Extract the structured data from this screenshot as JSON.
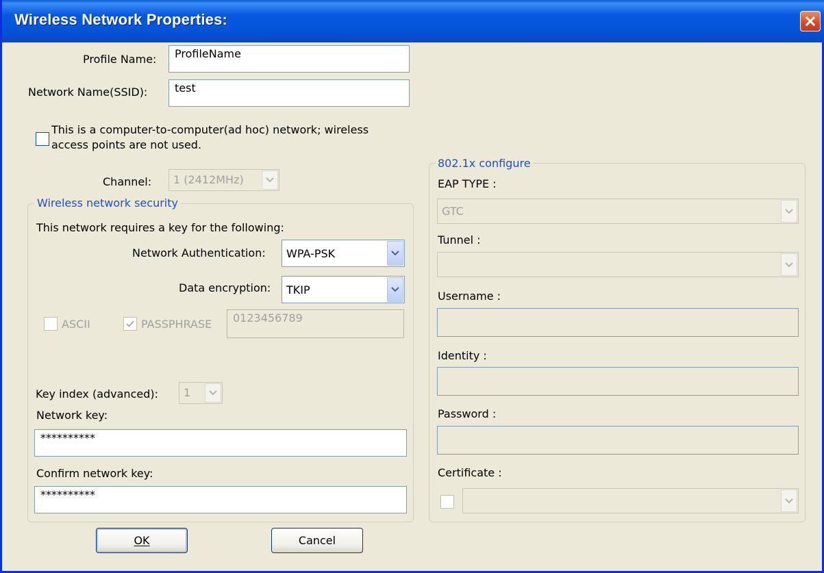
{
  "window": {
    "title": "Wireless Network Properties:"
  },
  "profile": {
    "label": "Profile Name:",
    "value": "ProfileName"
  },
  "ssid": {
    "label": "Network Name(SSID):",
    "value": "test"
  },
  "adhoc": {
    "label_line1": "This is a computer-to-computer(ad hoc) network; wireless",
    "label_line2": "access points are not used."
  },
  "channel": {
    "label": "Channel:",
    "value": "1  (2412MHz)"
  },
  "security": {
    "title": "Wireless network security",
    "requires": "This network requires a key for the following:",
    "auth_label": "Network Authentication:",
    "auth_value": "WPA-PSK",
    "enc_label": "Data encryption:",
    "enc_value": "TKIP",
    "ascii_label": "ASCII",
    "passphrase_label": "PASSPHRASE",
    "passphrase_value": "0123456789",
    "key_index_label": "Key index (advanced):",
    "key_index_value": "1",
    "network_key_label": "Network key:",
    "network_key_value": "**********",
    "confirm_key_label": "Confirm network key:",
    "confirm_key_value": "**********"
  },
  "dot1x": {
    "title": "802.1x configure",
    "eap_label": "EAP TYPE :",
    "eap_value": "GTC",
    "tunnel_label": "Tunnel :",
    "tunnel_value": "",
    "username_label": "Username :",
    "identity_label": "Identity :",
    "password_label": "Password :",
    "certificate_label": "Certificate :"
  },
  "buttons": {
    "ok": "OK",
    "cancel": "Cancel"
  },
  "icons": {
    "close": "close-icon",
    "dropdown": "chevron-down-icon",
    "check": "check-icon"
  }
}
